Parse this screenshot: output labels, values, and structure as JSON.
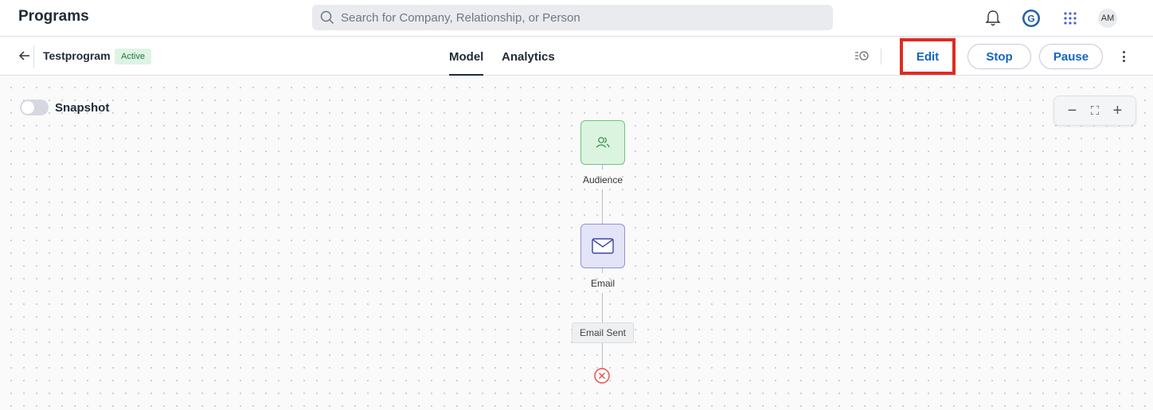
{
  "app": {
    "title": "Programs"
  },
  "search": {
    "placeholder": "Search for Company, Relationship, or Person"
  },
  "topbar": {
    "icons": [
      "bell-icon",
      "g-logo-icon",
      "apps-grid-icon"
    ],
    "avatar_initials": "AM"
  },
  "program": {
    "name": "Testprogram",
    "status": "Active"
  },
  "tabs": [
    {
      "label": "Model",
      "active": true
    },
    {
      "label": "Analytics",
      "active": false
    }
  ],
  "actions": {
    "edit": "Edit",
    "stop": "Stop",
    "pause": "Pause"
  },
  "canvas": {
    "snapshot_label": "Snapshot",
    "snapshot_on": false,
    "zoom": {
      "minus": "−",
      "fit": "⛶",
      "plus": "+"
    }
  },
  "flow": {
    "audience_label": "Audience",
    "email_label": "Email",
    "email_sent_label": "Email Sent"
  },
  "colors": {
    "accent": "#1565c0",
    "highlight": "#e02b20",
    "active_badge_bg": "#dff3e4",
    "audience_node": "#dbf4df",
    "email_node": "#e3e4f7",
    "end_icon": "#e5484d"
  }
}
